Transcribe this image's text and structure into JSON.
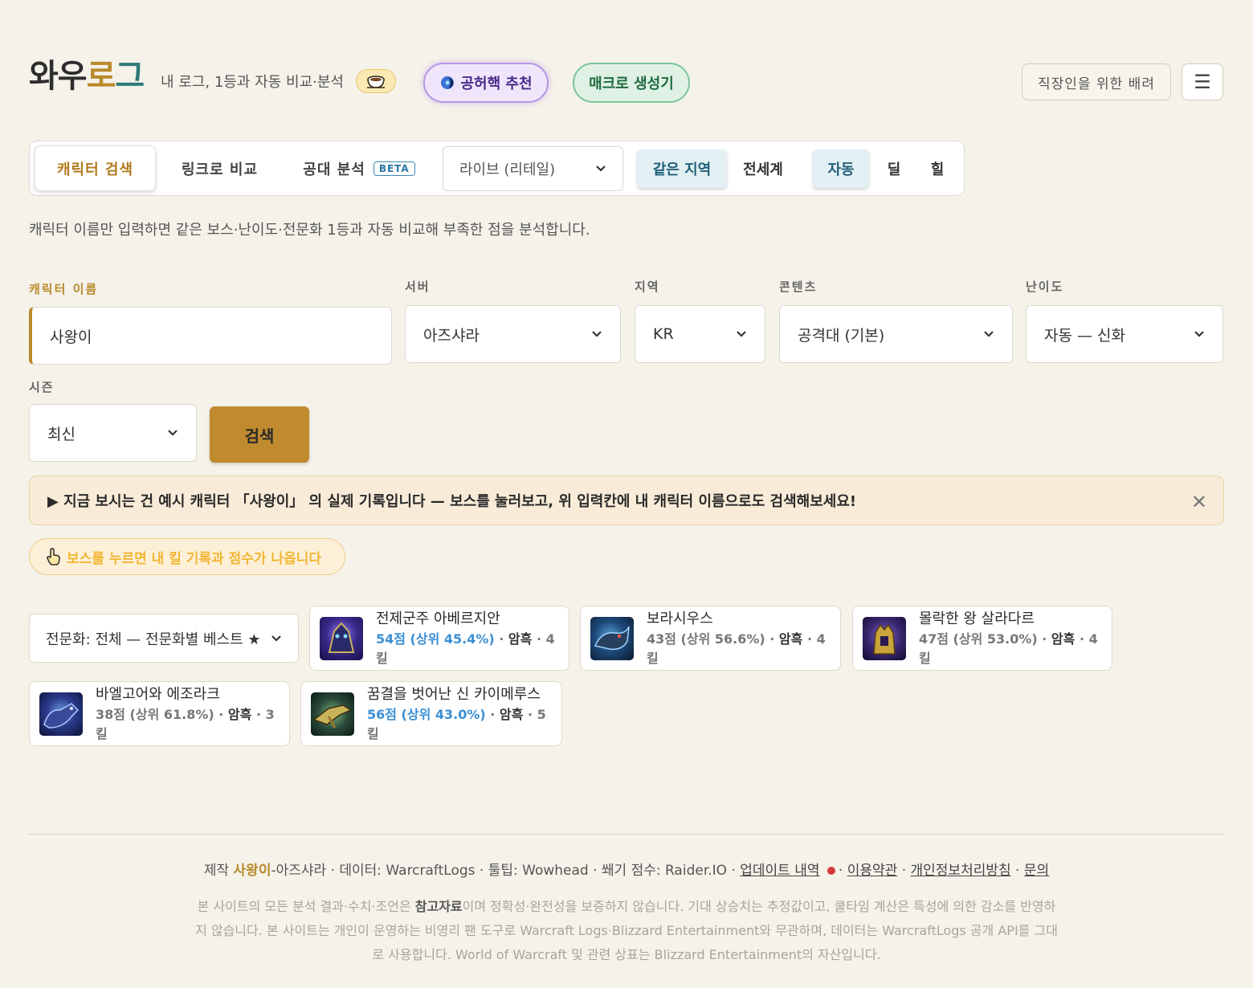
{
  "header": {
    "logo_part1": "와우",
    "logo_part2": "로",
    "logo_part3": "그",
    "tagline": "내 로그, 1등과 자동 비교·분석",
    "btn_recommend": "공허핵 추천",
    "btn_macro": "매크로 생성기",
    "btn_office": "직장인을 위한 배려",
    "menu_icon": "☰"
  },
  "tabs": {
    "items": [
      "캐릭터 검색",
      "링크로 비교",
      "공대 분석"
    ],
    "beta": "BETA",
    "version_select": "라이브 (리테일)",
    "region_toggle": [
      "같은 지역",
      "전세계"
    ],
    "role_toggle": [
      "자동",
      "딜",
      "힐"
    ]
  },
  "description": "캐릭터 이름만 입력하면 같은 보스·난이도·전문화 1등과 자동 비교해 부족한 점을 분석합니다.",
  "form": {
    "name_label": "캐릭터 이름",
    "name_value": "사왕이",
    "server_label": "서버",
    "server_value": "아즈샤라",
    "region_label": "지역",
    "region_value": "KR",
    "content_label": "콘텐츠",
    "content_value": "공격대 (기본)",
    "difficulty_label": "난이도",
    "difficulty_value": "자동 — 신화",
    "season_label": "시즌",
    "season_value": "최신",
    "search_button": "검색"
  },
  "notice": {
    "text": "▶ 지금 보시는 건 예시 캐릭터 「사왕이」 의 실제 기록입니다 — 보스를 눌러보고, 위 입력칸에 내 캐릭터 이름으로도 검색해보세요!",
    "close": "✕"
  },
  "hint": "보스를 누르면 내 킬 기록과 점수가 나옵니다",
  "spec_select": "전문화: 전체 — 전문화별 베스트 ★",
  "bosses": [
    {
      "name": "전제군주 아베르지안",
      "score": "54점 (상위 45.4%)",
      "class": "암흑",
      "kills": "4킬"
    },
    {
      "name": "보라시우스",
      "score": "43점 (상위 56.6%)",
      "class": "암흑",
      "kills": "4킬"
    },
    {
      "name": "몰락한 왕 살라다르",
      "score": "47점 (상위 53.0%)",
      "class": "암흑",
      "kills": "4킬"
    },
    {
      "name": "바엘고어와 에조라크",
      "score": "38점 (상위 61.8%)",
      "class": "암흑",
      "kills": "3킬"
    },
    {
      "name": "꿈결을 벗어난 신 카이메루스",
      "score": "56점 (상위 43.0%)",
      "class": "암흑",
      "kills": "5킬"
    }
  ],
  "colors": {
    "accent_gold": "#b88a2a",
    "accent_teal": "#2f7a78",
    "score_blue": "#3a8fd4",
    "background": "#f5f2ea"
  },
  "footer": {
    "made_by_prefix": "제작 ",
    "author": "사왕이",
    "credits_rest": "-아즈샤라 · 데이터: WarcraftLogs · 툴팁: Wowhead · 쐐기 점수: Raider.IO · ",
    "updates": "업데이트 내역",
    "terms": "이용약관",
    "privacy": "개인정보처리방침",
    "contact": "문의",
    "disclaimer_a": "본 사이트의 모든 분석 결과·수치·조언은 ",
    "disclaimer_bold": "참고자료",
    "disclaimer_b": "이며 정확성·완전성을 보증하지 않습니다. 기대 상승치는 추정값이고, 쿨타임 계산은 특성에 의한 감소를 반영하지 않습니다. 본 사이트는 개인이 운영하는 비영리 팬 도구로 Warcraft Logs·Blizzard Entertainment와 무관하며, 데이터는 WarcraftLogs 공개 API를 그대로 사용합니다. World of Warcraft 및 관련 상표는 Blizzard Entertainment의 자산입니다."
  }
}
